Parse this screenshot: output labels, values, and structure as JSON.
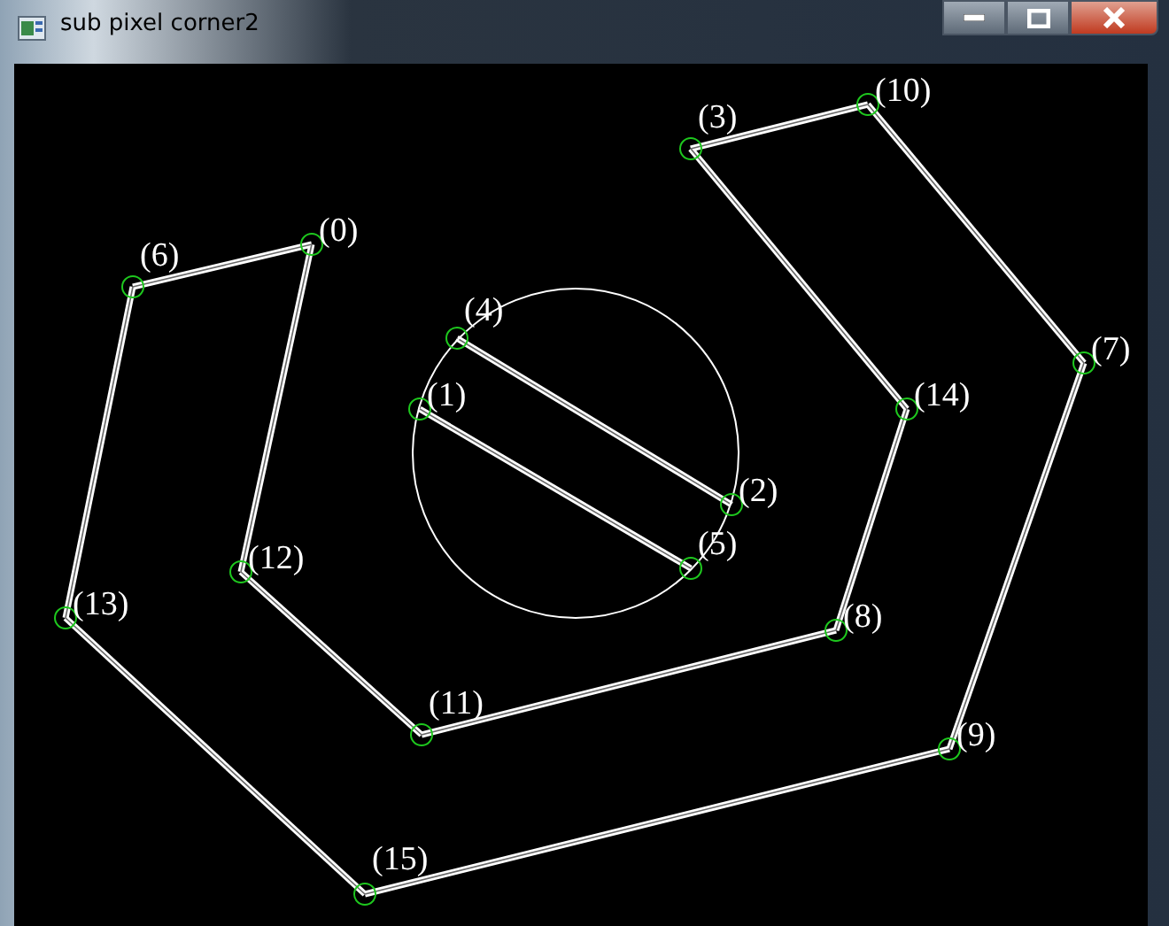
{
  "window": {
    "title": "sub pixel corner2"
  },
  "points": [
    {
      "label": "(0)"
    },
    {
      "label": "(1)"
    },
    {
      "label": "(2)"
    },
    {
      "label": "(3)"
    },
    {
      "label": "(4)"
    },
    {
      "label": "(5)"
    },
    {
      "label": "(6)"
    },
    {
      "label": "(7)"
    },
    {
      "label": "(8)"
    },
    {
      "label": "(9)"
    },
    {
      "label": "(10)"
    },
    {
      "label": "(11)"
    },
    {
      "label": "(12)"
    },
    {
      "label": "(13)"
    },
    {
      "label": "(14)"
    },
    {
      "label": "(15)"
    }
  ]
}
